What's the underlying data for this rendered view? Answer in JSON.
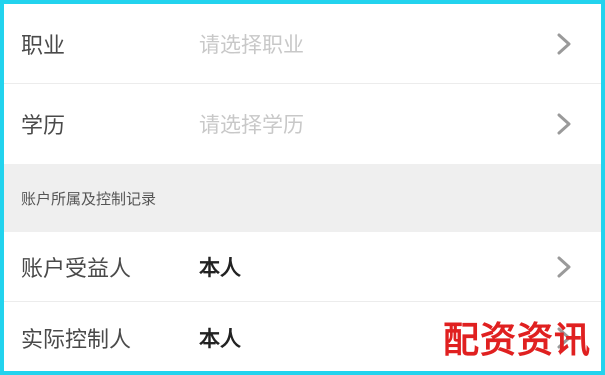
{
  "rows_top": [
    {
      "label": "职业",
      "value": "请选择职业",
      "placeholder": true
    },
    {
      "label": "学历",
      "value": "请选择学历",
      "placeholder": true
    }
  ],
  "section": {
    "title": "账户所属及控制记录"
  },
  "rows_bottom": [
    {
      "label": "账户受益人",
      "value": "本人",
      "placeholder": false
    },
    {
      "label": "实际控制人",
      "value": "本人",
      "placeholder": false
    }
  ],
  "watermark": "配资资讯",
  "colors": {
    "border": "#22d3ee",
    "section_bg": "#efefef",
    "placeholder": "#c8c8c8",
    "watermark": "#e02020"
  }
}
